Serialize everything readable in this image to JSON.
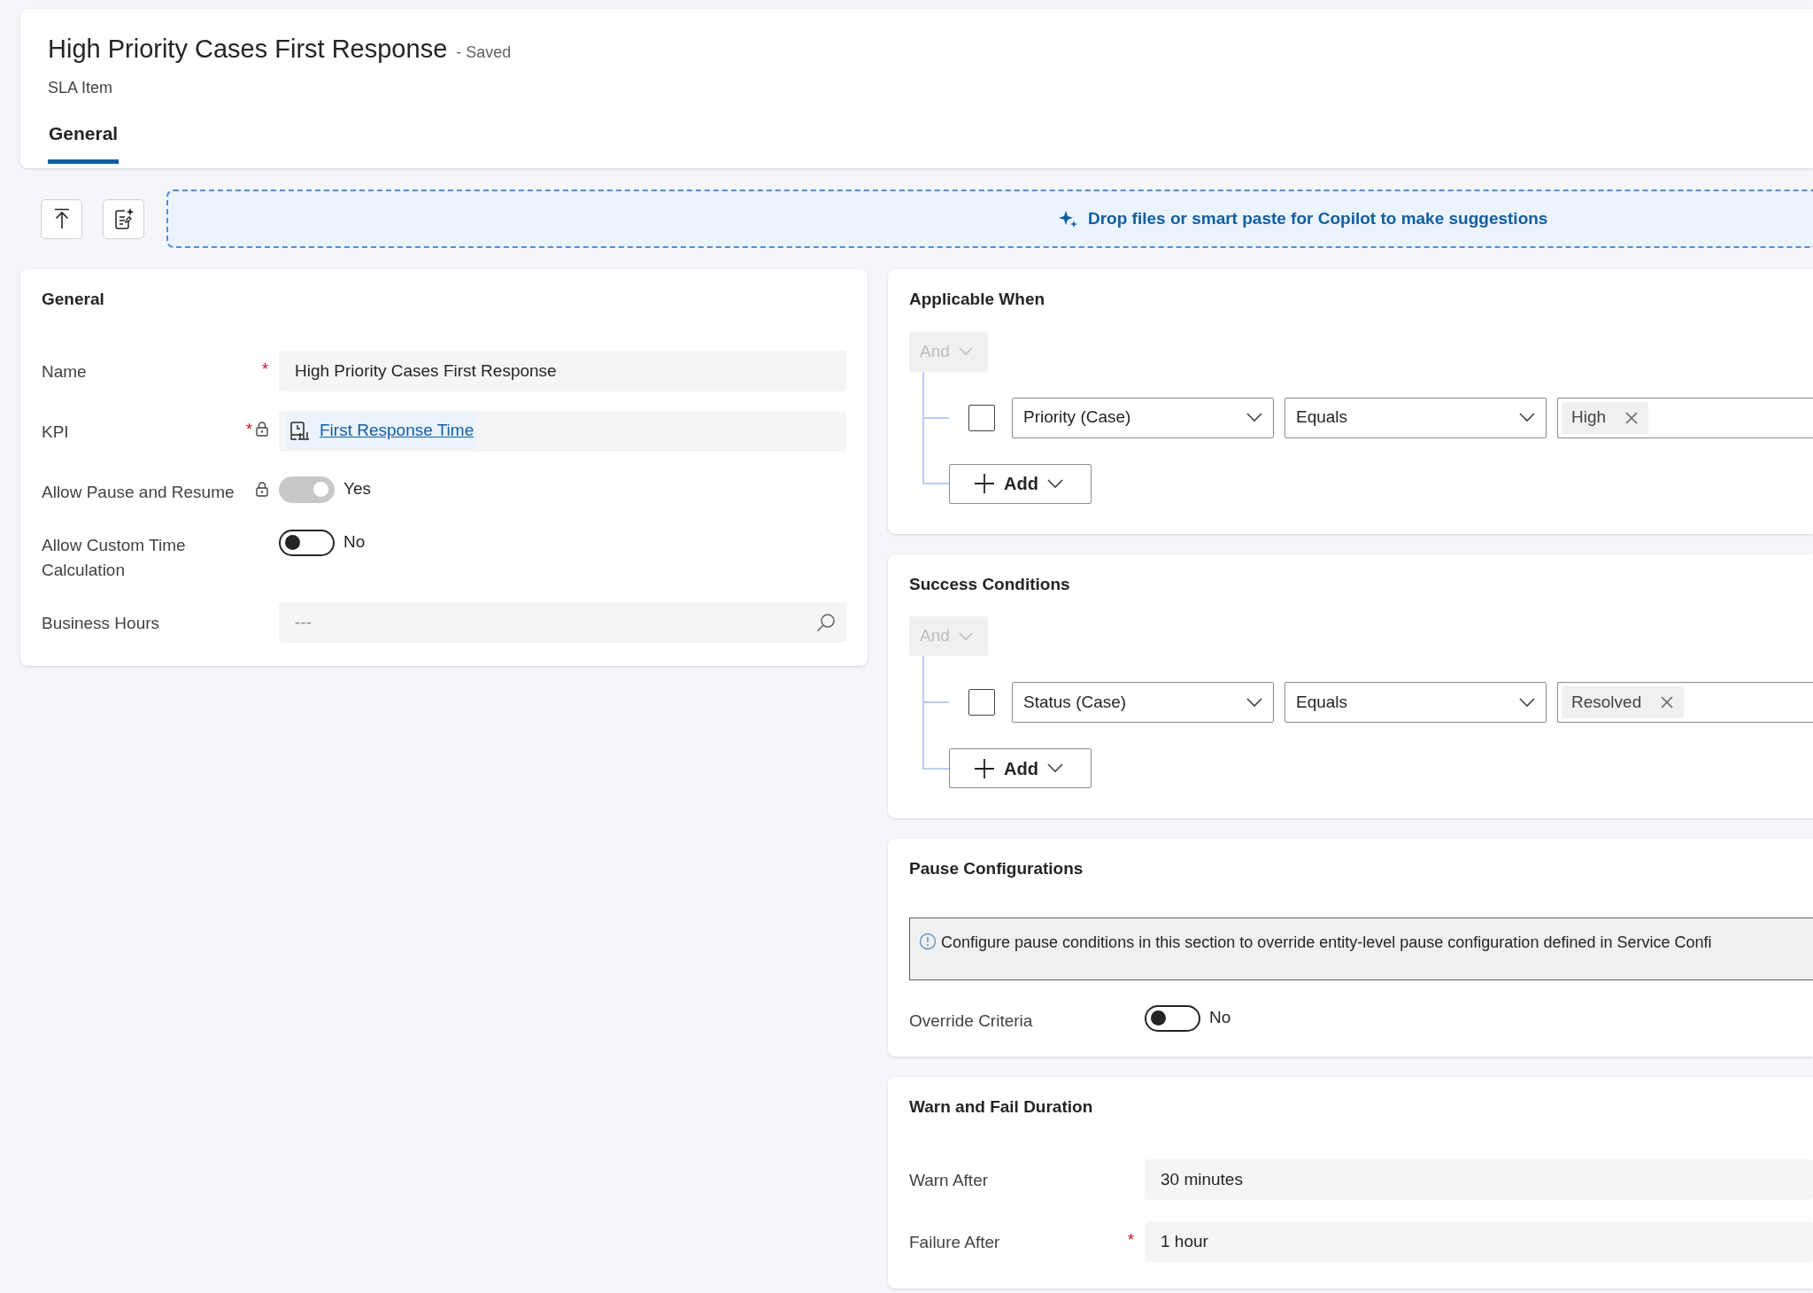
{
  "header": {
    "title": "High Priority Cases First Response",
    "status": "- Saved",
    "subtitle": "SLA Item"
  },
  "tabs": [
    {
      "label": "General",
      "selected": true
    }
  ],
  "drop_zone": {
    "text": "Drop files or smart paste for Copilot to make suggestions"
  },
  "general": {
    "title": "General",
    "fields": [
      {
        "kind": "text",
        "label": "Name",
        "required_mark": "*",
        "locked": false,
        "value": "High Priority Cases First Response"
      },
      {
        "kind": "lookup",
        "label": "KPI",
        "required_mark": "*",
        "locked": true,
        "value": "First Response Time"
      },
      {
        "kind": "toggle",
        "label": "Allow Pause and Resume",
        "locked": true,
        "on": true,
        "disabled": true,
        "value": "Yes"
      },
      {
        "kind": "toggle",
        "label": "Allow Custom Time Calculation",
        "locked": false,
        "on": false,
        "disabled": false,
        "value": "No"
      },
      {
        "kind": "search",
        "label": "Business Hours",
        "locked": false,
        "placeholder": "---"
      }
    ]
  },
  "condition_sections": [
    {
      "title": "Applicable When",
      "operator": "And",
      "conditions": [
        {
          "checked": false,
          "field": "Priority (Case)",
          "comparison": "Equals",
          "values": [
            "High"
          ]
        }
      ],
      "add_label": "Add"
    },
    {
      "title": "Success Conditions",
      "operator": "And",
      "conditions": [
        {
          "checked": false,
          "field": "Status (Case)",
          "comparison": "Equals",
          "values": [
            "Resolved"
          ]
        }
      ],
      "add_label": "Add"
    }
  ],
  "pause": {
    "title": "Pause Configurations",
    "info": "Configure pause conditions in this section to override entity-level pause configuration defined in Service Confi",
    "fields": [
      {
        "kind": "toggle",
        "label": "Override Criteria",
        "locked": false,
        "on": false,
        "disabled": false,
        "value": "No"
      }
    ]
  },
  "duration": {
    "title": "Warn and Fail Duration",
    "fields": [
      {
        "kind": "text",
        "label": "Warn After",
        "locked": false,
        "value": "30 minutes"
      },
      {
        "kind": "text",
        "label": "Failure After",
        "required_mark": "*",
        "locked": false,
        "value": "1 hour"
      }
    ]
  }
}
